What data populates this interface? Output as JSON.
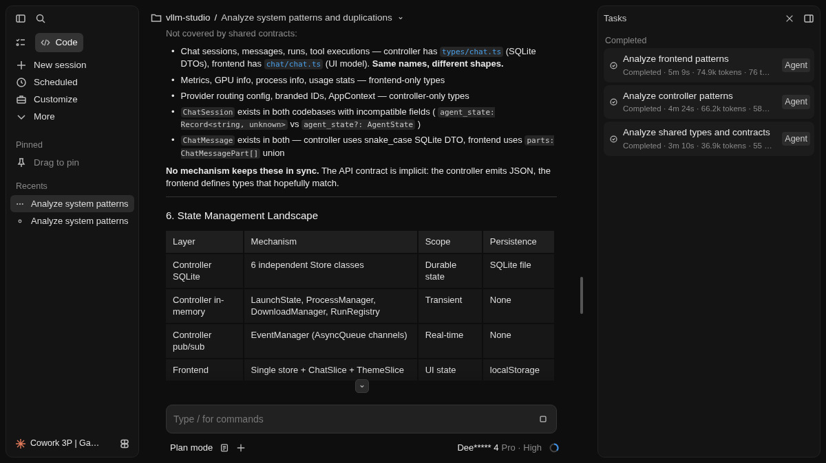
{
  "sidebar": {
    "mode_button": "Code",
    "nav": [
      {
        "label": "New session"
      },
      {
        "label": "Scheduled"
      },
      {
        "label": "Customize"
      },
      {
        "label": "More"
      }
    ],
    "pinned_heading": "Pinned",
    "pin_hint": "Drag to pin",
    "recents_heading": "Recents",
    "recents": [
      {
        "label": "Analyze system patterns",
        "selected": true,
        "running": true
      },
      {
        "label": "Analyze system patterns",
        "selected": false,
        "running": false
      }
    ],
    "account": "Cowork 3P | Ga…"
  },
  "breadcrumb": {
    "project": "vllm-studio",
    "separator": "/",
    "session": "Analyze system patterns and duplications"
  },
  "content": {
    "intro": "Not covered by shared contracts:",
    "bullets": [
      {
        "marker": "•",
        "segments": [
          {
            "kind": "text",
            "text": "Chat sessions, messages, runs, tool executions — controller has"
          },
          {
            "kind": "path",
            "text": "types/chat.ts"
          },
          {
            "kind": "text",
            "text": "(SQLite DTOs), frontend has"
          },
          {
            "kind": "path",
            "text": "chat/chat.ts"
          },
          {
            "kind": "text",
            "text": "(UI model). **Same names, different shapes.**"
          }
        ]
      },
      {
        "marker": "•",
        "segments": [
          {
            "kind": "text",
            "text": "Metrics, GPU info, process info, usage stats — frontend-only types"
          }
        ]
      },
      {
        "marker": "•",
        "segments": [
          {
            "kind": "text",
            "text": "Provider routing config, branded IDs, AppContext — controller-only types"
          }
        ]
      },
      {
        "marker": "•",
        "segments": [
          {
            "kind": "code",
            "text": "ChatSession"
          },
          {
            "kind": "text",
            "text": "exists in both codebases with incompatible fields ("
          },
          {
            "kind": "code",
            "text": "agent_state: Record<string, unknown>"
          },
          {
            "kind": "text",
            "text": "vs"
          },
          {
            "kind": "code",
            "text": "agent_state?: AgentState"
          },
          {
            "kind": "text",
            "text": ")"
          }
        ]
      },
      {
        "marker": "•",
        "segments": [
          {
            "kind": "code",
            "text": "ChatMessage"
          },
          {
            "kind": "text",
            "text": "exists in both — controller uses snake_case SQLite DTO, frontend uses"
          },
          {
            "kind": "code",
            "text": "parts: ChatMessagePart[]"
          },
          {
            "kind": "text",
            "text": "union"
          }
        ]
      }
    ],
    "summary": "**No mechanism keeps these in sync.** The API contract is implicit: the controller emits JSON, the frontend defines types that hopefully match.",
    "heading": "6. State Management Landscape",
    "table": {
      "columns": [
        "Layer",
        "Mechanism",
        "Scope",
        "Persistence"
      ],
      "rows": [
        [
          "Controller SQLite",
          "6 independent Store classes",
          "Durable state",
          "SQLite file"
        ],
        [
          "Controller in-memory",
          "LaunchState, ProcessManager, DownloadManager, RunRegistry",
          "Transient",
          "None"
        ],
        [
          "Controller pub/sub",
          "EventManager (AsyncQueue channels)",
          "Real-time",
          "None"
        ],
        [
          "Frontend",
          "Single store + ChatSlice + ThemeSlice",
          "UI state",
          "localStorage"
        ]
      ]
    }
  },
  "composer": {
    "placeholder": "Type / for commands",
    "plan_mode": "Plan mode",
    "model": "Dee***** 4",
    "model_detail": "Pro · High"
  },
  "tasks": {
    "title": "Tasks",
    "group": "Completed",
    "items": [
      {
        "title": "Analyze frontend patterns",
        "detail": "Completed · 5m 9s · 74.9k tokens · 76 t…",
        "badge": "Agent"
      },
      {
        "title": "Analyze controller patterns",
        "detail": "Completed · 4m 24s · 66.2k tokens · 58…",
        "badge": "Agent"
      },
      {
        "title": "Analyze shared types and contracts",
        "detail": "Completed · 3m 10s · 36.9k tokens · 55 …",
        "badge": "Agent"
      }
    ]
  }
}
